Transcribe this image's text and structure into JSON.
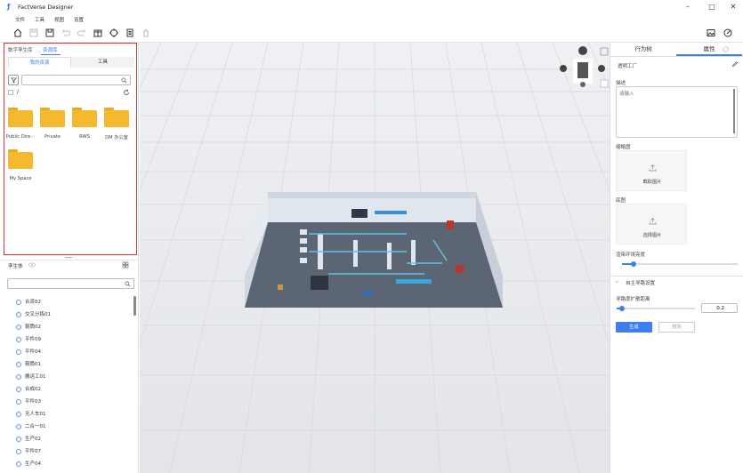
{
  "app": {
    "title": "FactVerse Designer"
  },
  "menu": [
    {
      "label": "文件"
    },
    {
      "label": "工具"
    },
    {
      "label": "视图"
    },
    {
      "label": "设置"
    }
  ],
  "left": {
    "tabs": [
      "数字孪生库",
      "资源库"
    ],
    "active_tab": "资源库",
    "subtabs": [
      "我的资源",
      "工具"
    ],
    "path": "/",
    "folders": [
      {
        "label": "Public Dire···"
      },
      {
        "label": "Private"
      },
      {
        "label": "RWS"
      },
      {
        "label": "DM 办公室"
      },
      {
        "label": "My Space"
      }
    ],
    "twin_header": "孪生体",
    "tree_items": [
      "合流02",
      "交叉分拣01",
      "辊筒02",
      "平件09",
      "平件04",
      "辊筒01",
      "搬运工01",
      "合成02",
      "平件03",
      "无人车01",
      "二合一01",
      "生产02",
      "平件07",
      "生产04"
    ]
  },
  "right": {
    "tabs": [
      "行为树",
      "属性"
    ],
    "active_tab": "属性",
    "object_name": "透明工厂",
    "desc_label": "描述",
    "desc_placeholder": "请输入",
    "thumb_label": "缩略图",
    "thumb_button": "截取图片",
    "base_label": "底图",
    "base_button": "选择图片",
    "brightness_label": "渲染环境亮度",
    "brightness_value": 0.1,
    "nav_section": "自主寻路设置",
    "nav_radius_label": "寻路度扩散距离",
    "nav_radius_value": "0.2",
    "generate_button": "生成",
    "delete_button": "删除"
  }
}
